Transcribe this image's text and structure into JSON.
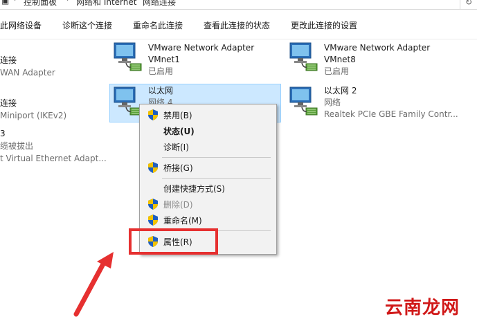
{
  "breadcrumb": {
    "items": [
      "控制面板",
      "网络和 Internet",
      "网络连接"
    ]
  },
  "toolbar": {
    "buttons": [
      "此网络设备",
      "诊断这个连接",
      "重命名此连接",
      "查看此连接的状态",
      "更改此连接的设置"
    ]
  },
  "adapters": {
    "left1": {
      "name": "连接",
      "device": "WAN Adapter"
    },
    "left2": {
      "name": "连接",
      "device": "Miniport (IKEv2)"
    },
    "left3": {
      "name": "3",
      "status": "缆被拔出",
      "device": "t Virtual Ethernet Adapt..."
    },
    "vmnet1": {
      "name": "VMware Network Adapter",
      "name2": "VMnet1",
      "status": "已启用"
    },
    "vmnet8": {
      "name": "VMware Network Adapter",
      "name2": "VMnet8",
      "status": "已启用"
    },
    "ethernet": {
      "name": "以太网",
      "status": "网络 4"
    },
    "ethernet2": {
      "name": "以太网 2",
      "status": "网络",
      "device": "Realtek PCIe GBE Family Contr..."
    }
  },
  "context_menu": {
    "disable": "禁用(B)",
    "status": "状态(U)",
    "diagnose": "诊断(I)",
    "bridge": "桥接(G)",
    "shortcut": "创建快捷方式(S)",
    "delete": "删除(D)",
    "rename": "重命名(M)",
    "properties": "属性(R)"
  },
  "watermark": "云南龙网",
  "colors": {
    "selection": "#cce8ff",
    "highlight": "#e63030",
    "watermark": "#d01818"
  }
}
